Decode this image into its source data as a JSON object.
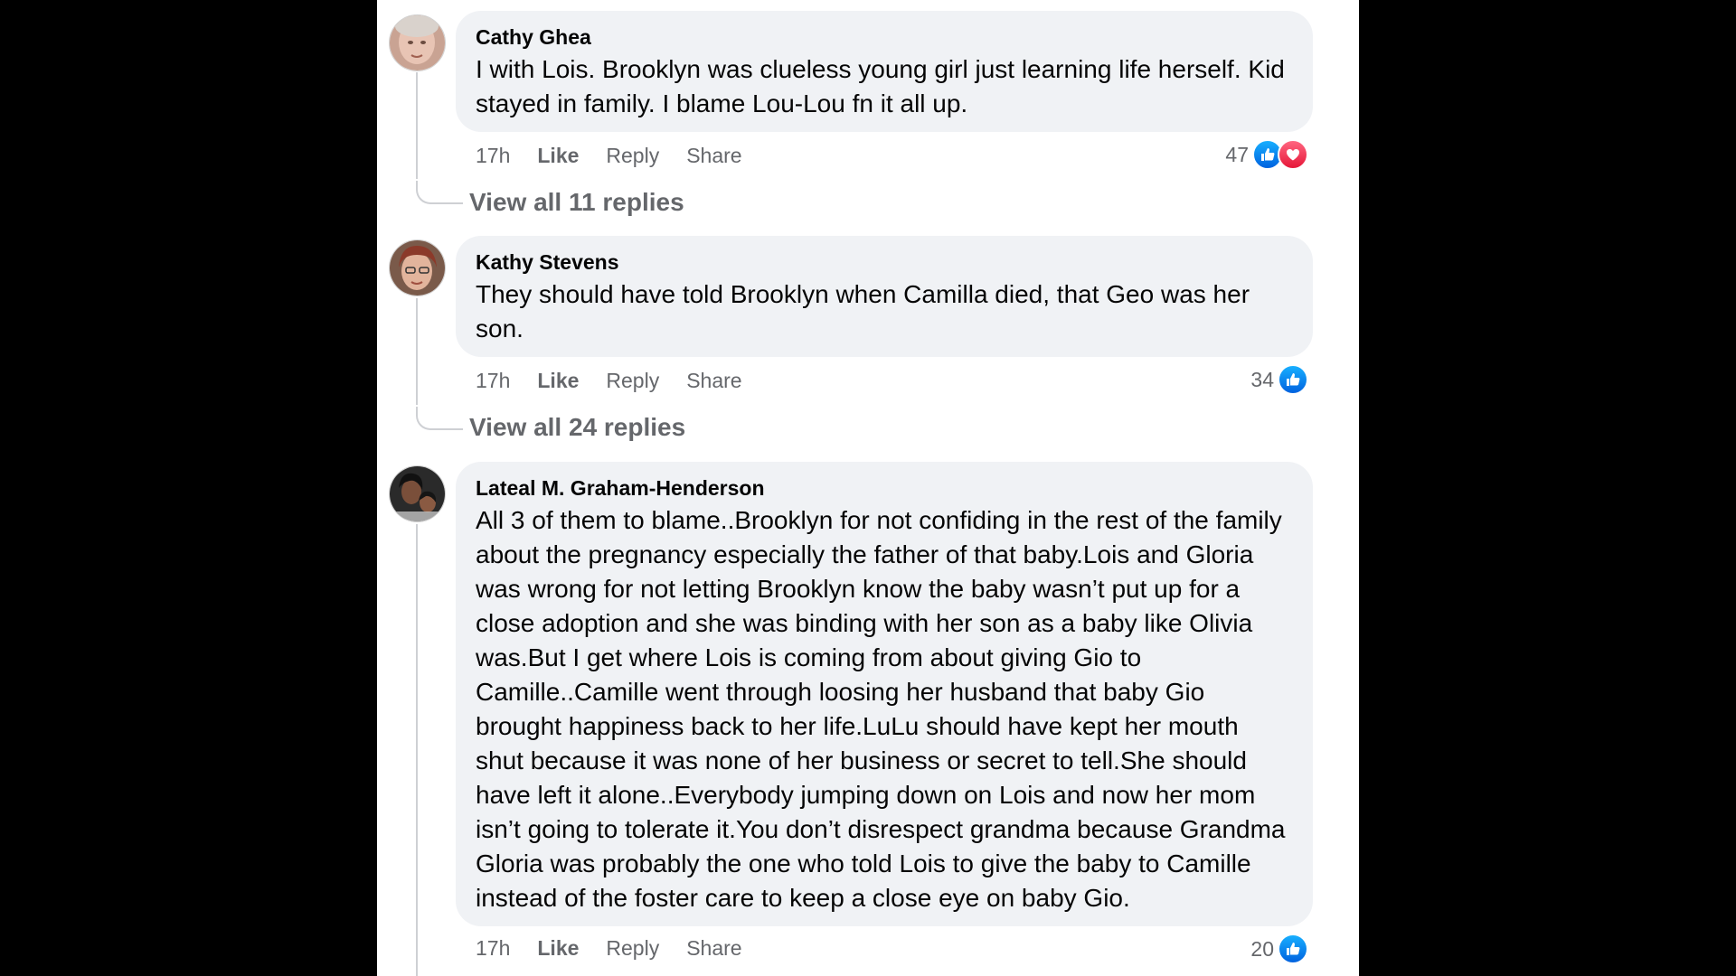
{
  "comments": [
    {
      "author": "Cathy Ghea",
      "text": "I with Lois. Brooklyn was clueless young girl just learning life herself. Kid stayed in family. I blame Lou-Lou fn it all up.",
      "time": "17h",
      "like_label": "Like",
      "reply_label": "Reply",
      "share_label": "Share",
      "reaction_count": "47",
      "reactions": [
        "like-icon",
        "love-icon"
      ],
      "view_replies": "View all 11 replies"
    },
    {
      "author": "Kathy Stevens",
      "text": "They should have told Brooklyn when Camilla died, that Geo was her son.",
      "time": "17h",
      "like_label": "Like",
      "reply_label": "Reply",
      "share_label": "Share",
      "reaction_count": "34",
      "reactions": [
        "like-icon"
      ],
      "view_replies": "View all 24 replies"
    },
    {
      "author": "Lateal M. Graham-Henderson",
      "text": "All 3 of them to blame..Brooklyn for not confiding in the rest of the family about the pregnancy especially the father of that baby.Lois and Gloria was wrong for not letting Brooklyn know the baby wasn’t put up for a close adoption and she was binding with her son as a baby like Olivia was.But I get where Lois is coming from about giving Gio to Camille..Camille went through loosing her husband that baby Gio brought happiness back to her life.LuLu should have kept her mouth shut because it was none of her business or secret to tell.She should have left it alone..Everybody jumping down on Lois and now her mom isn’t going to tolerate it.You don’t disrespect grandma because Grandma Gloria was probably the one who told Lois to give the baby to Camille instead of the foster care to keep a close eye on baby Gio.",
      "time": "17h",
      "like_label": "Like",
      "reply_label": "Reply",
      "share_label": "Share",
      "reaction_count": "20",
      "reactions": [
        "like-icon"
      ]
    }
  ],
  "colors": {
    "background": "#000000",
    "panel": "#ffffff",
    "bubble": "#f0f2f5",
    "secondary_text": "#65676b",
    "like_blue": "#1877f2",
    "love_red": "#f33e58"
  }
}
